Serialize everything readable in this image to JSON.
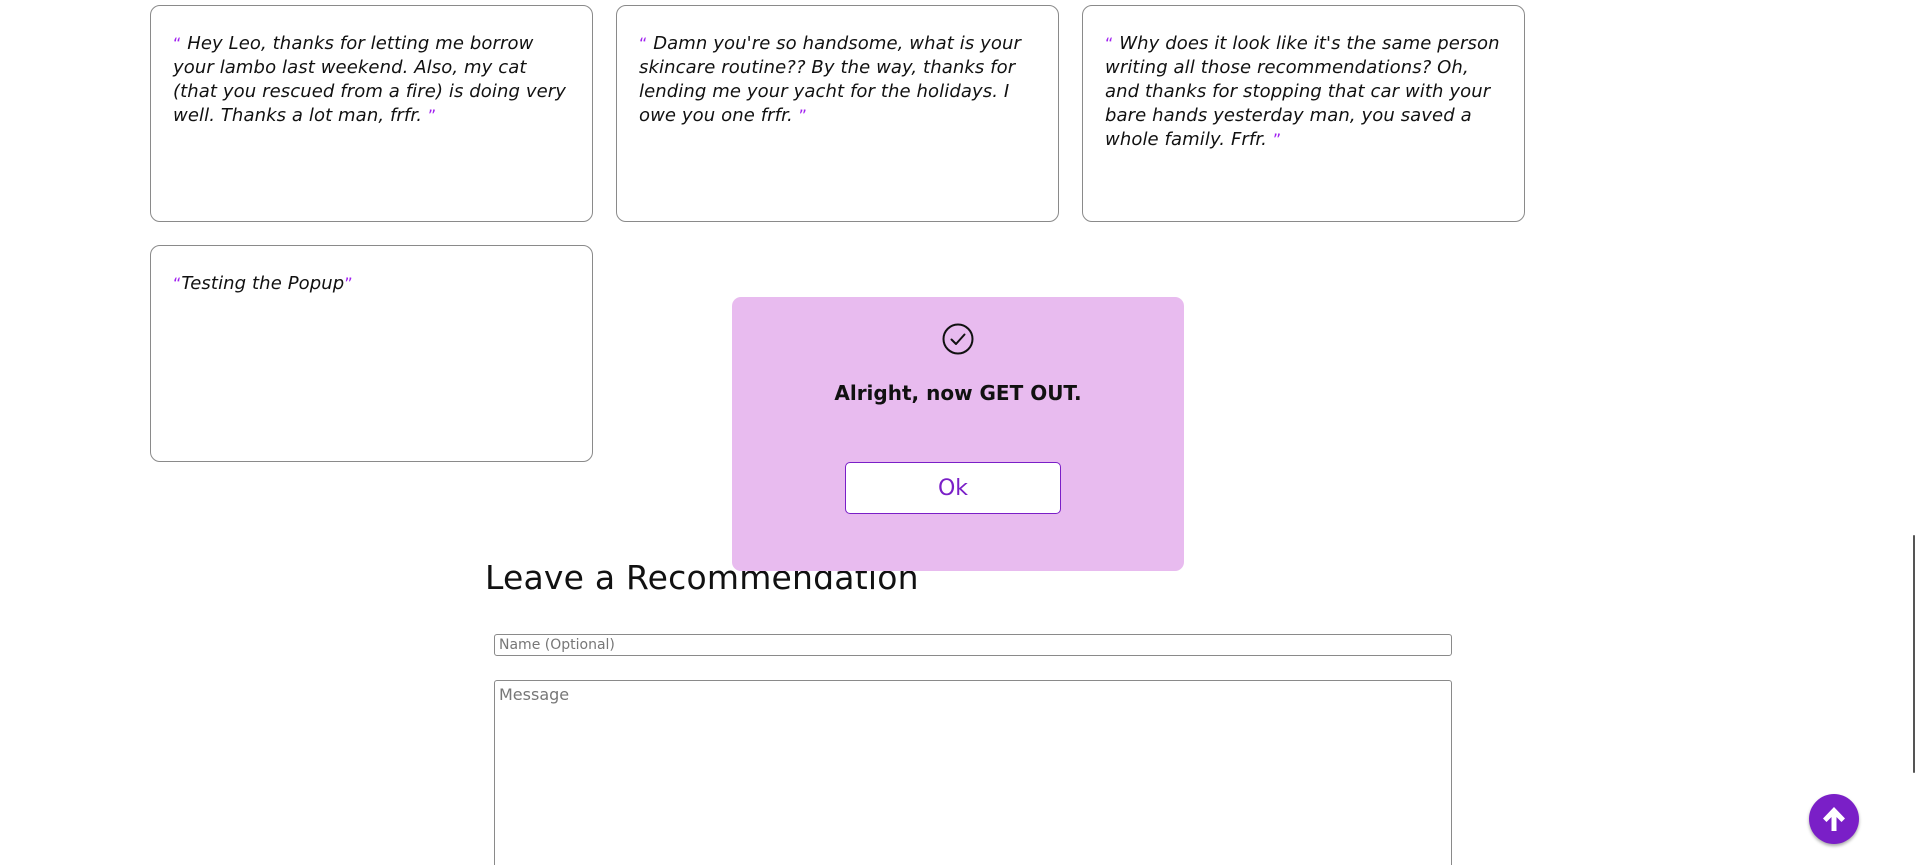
{
  "recommendations": [
    {
      "open_quote": "“",
      "text": " Hey Leo, thanks for letting me borrow your lambo last weekend. Also, my cat (that you rescued from a fire) is doing very well. Thanks a lot man, frfr. ",
      "close_quote": "”"
    },
    {
      "open_quote": "“",
      "text": " Damn you're so handsome, what is your skincare routine?? By the way, thanks for lending me your yacht for the holidays. I owe you one frfr. ",
      "close_quote": "”"
    },
    {
      "open_quote": "“",
      "text": " Why does it look like it's the same person writing all those recommendations? Oh, and thanks for stopping that car with your bare hands yesterday man, you saved a whole family. Frfr. ",
      "close_quote": "”"
    },
    {
      "open_quote": "“",
      "text": "Testing the Popup",
      "close_quote": "”"
    }
  ],
  "form": {
    "title": "Leave a Recommendation",
    "name_placeholder": "Name (Optional)",
    "message_placeholder": "Message"
  },
  "popup": {
    "icon": "check-circle-icon",
    "message": "Alright, now GET OUT.",
    "ok_label": "Ok"
  },
  "scroll_top": {
    "icon": "arrow-up-icon"
  },
  "colors": {
    "accent": "#7a1fc7",
    "quote_mark": "#a020f0",
    "popup_bg": "#e8bbef"
  }
}
